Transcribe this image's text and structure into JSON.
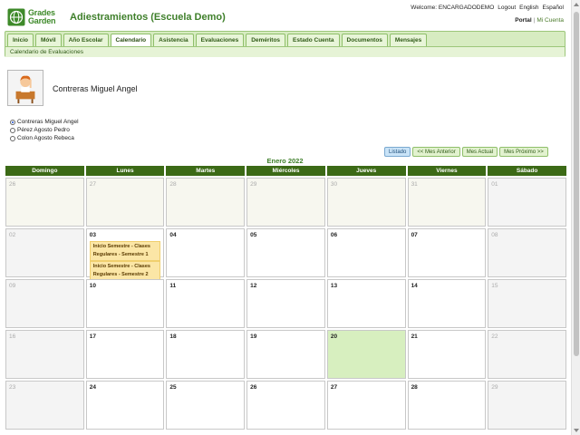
{
  "brand": {
    "logo_line1": "Grades",
    "logo_line2": "Garden",
    "app_title": "Adiestramientos (Escuela Demo)"
  },
  "topbar": {
    "welcome": "Welcome: ENCARGADODEMO",
    "logout": "Logout",
    "english": "English",
    "espanol": "Español",
    "portal": "Portal",
    "separator": "|",
    "mi_cuenta": "Mi Cuenta"
  },
  "nav": {
    "tabs": [
      "Inicio",
      "Móvil",
      "Año Escolar",
      "Calendario",
      "Asistencia",
      "Evaluaciones",
      "Deméritos",
      "Estado Cuenta",
      "Documentos",
      "Mensajes"
    ],
    "active_tab": "Calendario",
    "subnav": "Calendario de Evaluaciones"
  },
  "student": {
    "selected_name": "Contreras Miguel Angel",
    "options": [
      "Contreras Miguel Angel",
      "Pérez Agosto Pedro",
      "Colon Agosto Rebeca"
    ],
    "selected_index": 0
  },
  "buttons": {
    "listado": "Listado",
    "prev": "<< Mes Anterior",
    "current": "Mes Actual",
    "next": "Mes Próximo >>"
  },
  "calendar": {
    "month_title": "Enero 2022",
    "weekdays": [
      "Domingo",
      "Lunes",
      "Martes",
      "Miércoles",
      "Jueves",
      "Viernes",
      "Sábado"
    ],
    "rows": [
      [
        {
          "d": "26",
          "t": "other"
        },
        {
          "d": "27",
          "t": "other"
        },
        {
          "d": "28",
          "t": "other"
        },
        {
          "d": "29",
          "t": "other"
        },
        {
          "d": "30",
          "t": "other"
        },
        {
          "d": "31",
          "t": "other"
        },
        {
          "d": "01",
          "t": "weekend"
        }
      ],
      [
        {
          "d": "02",
          "t": "weekend"
        },
        {
          "d": "03",
          "t": "day",
          "events": [
            "Inicio Semestre - Clases Regulares - Semestre 1",
            "Inicio Semestre - Clases Regulares - Semestre 2"
          ]
        },
        {
          "d": "04",
          "t": "day"
        },
        {
          "d": "05",
          "t": "day"
        },
        {
          "d": "06",
          "t": "day"
        },
        {
          "d": "07",
          "t": "day"
        },
        {
          "d": "08",
          "t": "weekend"
        }
      ],
      [
        {
          "d": "09",
          "t": "weekend"
        },
        {
          "d": "10",
          "t": "day"
        },
        {
          "d": "11",
          "t": "day"
        },
        {
          "d": "12",
          "t": "day"
        },
        {
          "d": "13",
          "t": "day"
        },
        {
          "d": "14",
          "t": "day"
        },
        {
          "d": "15",
          "t": "weekend"
        }
      ],
      [
        {
          "d": "16",
          "t": "weekend"
        },
        {
          "d": "17",
          "t": "day"
        },
        {
          "d": "18",
          "t": "day"
        },
        {
          "d": "19",
          "t": "day"
        },
        {
          "d": "20",
          "t": "today"
        },
        {
          "d": "21",
          "t": "day"
        },
        {
          "d": "22",
          "t": "weekend"
        }
      ],
      [
        {
          "d": "23",
          "t": "weekend"
        },
        {
          "d": "24",
          "t": "day"
        },
        {
          "d": "25",
          "t": "day"
        },
        {
          "d": "26",
          "t": "day"
        },
        {
          "d": "27",
          "t": "day"
        },
        {
          "d": "28",
          "t": "day"
        },
        {
          "d": "29",
          "t": "weekend"
        }
      ]
    ]
  }
}
